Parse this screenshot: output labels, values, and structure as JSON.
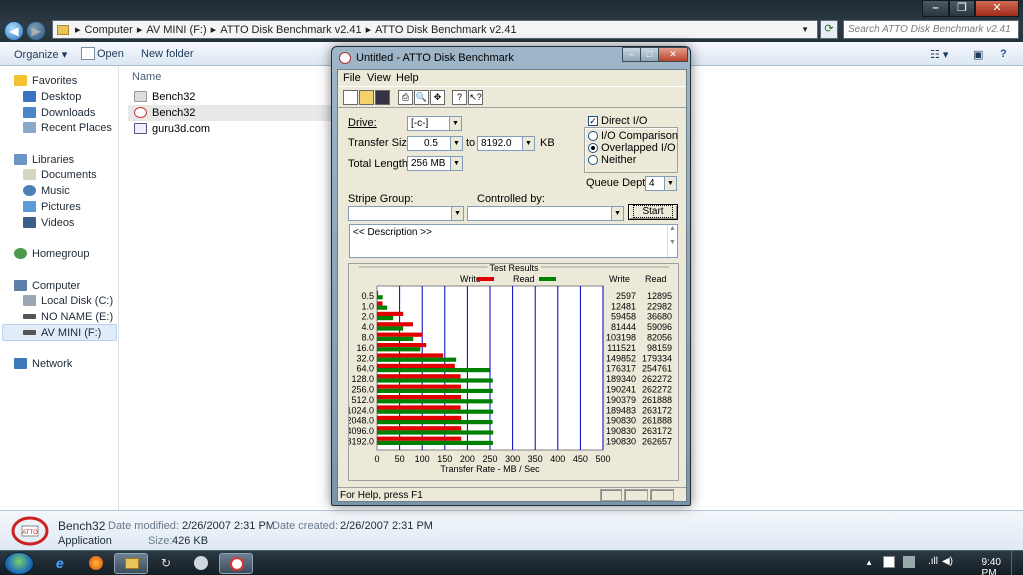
{
  "explorer": {
    "breadcrumb": [
      "Computer",
      "AV MINI (F:)",
      "ATTO Disk Benchmark v2.41",
      "ATTO Disk Benchmark v2.41"
    ],
    "search_placeholder": "Search ATTO Disk Benchmark v2.41",
    "commands": {
      "organize": "Organize ▾",
      "open": "Open",
      "new_folder": "New folder"
    },
    "column_name": "Name",
    "files": [
      "Bench32",
      "Bench32",
      "guru3d.com"
    ],
    "nav": {
      "favorites": "Favorites",
      "desktop": "Desktop",
      "downloads": "Downloads",
      "recent": "Recent Places",
      "libraries": "Libraries",
      "documents": "Documents",
      "music": "Music",
      "pictures": "Pictures",
      "videos": "Videos",
      "homegroup": "Homegroup",
      "computer": "Computer",
      "local_disk": "Local Disk (C:)",
      "no_name": "NO NAME (E:)",
      "av_mini": "AV MINI (F:)",
      "network": "Network"
    },
    "details": {
      "name": "Bench32",
      "type": "Application",
      "modified_label": "Date modified:",
      "modified": "2/26/2007 2:31 PM",
      "created_label": "Date created:",
      "created": "2/26/2007 2:31 PM",
      "size_label": "Size:",
      "size": "426 KB"
    }
  },
  "taskbar": {
    "time": "9:40 PM"
  },
  "atto": {
    "title": "Untitled - ATTO Disk Benchmark",
    "menu": [
      "File",
      "View",
      "Help"
    ],
    "drive_label": "Drive:",
    "drive_value": "[-c-]",
    "transfer_label": "Transfer Size:",
    "transfer_from": "0.5",
    "to_label": "to",
    "transfer_to": "8192.0",
    "kb_label": "KB",
    "length_label": "Total Length:",
    "length_value": "256 MB",
    "direct_io": "Direct I/O",
    "io_comparison": "I/O Comparison",
    "overlapped_io": "Overlapped I/O",
    "neither": "Neither",
    "queue_label": "Queue Depth:",
    "queue_value": "4",
    "stripe_label": "Stripe Group:",
    "controlled_label": "Controlled by:",
    "start_button": "Start",
    "description": "<< Description >>",
    "status": "For Help, press F1"
  },
  "chart_data": {
    "type": "bar",
    "title": "Test Results",
    "xlabel": "Transfer Rate - MB / Sec",
    "xlim": [
      0,
      500
    ],
    "xticks": [
      0,
      50,
      100,
      150,
      200,
      250,
      300,
      350,
      400,
      450,
      500
    ],
    "categories": [
      "0.5",
      "1.0",
      "2.0",
      "4.0",
      "8.0",
      "16.0",
      "32.0",
      "64.0",
      "128.0",
      "256.0",
      "512.0",
      "1024.0",
      "2048.0",
      "4096.0",
      "8192.0"
    ],
    "series": [
      {
        "name": "Write",
        "color": "#e00000",
        "values": [
          2597,
          12481,
          59458,
          81444,
          103198,
          111521,
          149852,
          176317,
          189340,
          190241,
          190379,
          189483,
          190830,
          190830,
          190830
        ]
      },
      {
        "name": "Read",
        "color": "#008000",
        "values": [
          12895,
          22982,
          36680,
          59096,
          82056,
          98159,
          179334,
          254761,
          262272,
          262272,
          261888,
          263172,
          261888,
          263172,
          262657
        ]
      }
    ],
    "table_headers": [
      "Write",
      "Read"
    ]
  }
}
